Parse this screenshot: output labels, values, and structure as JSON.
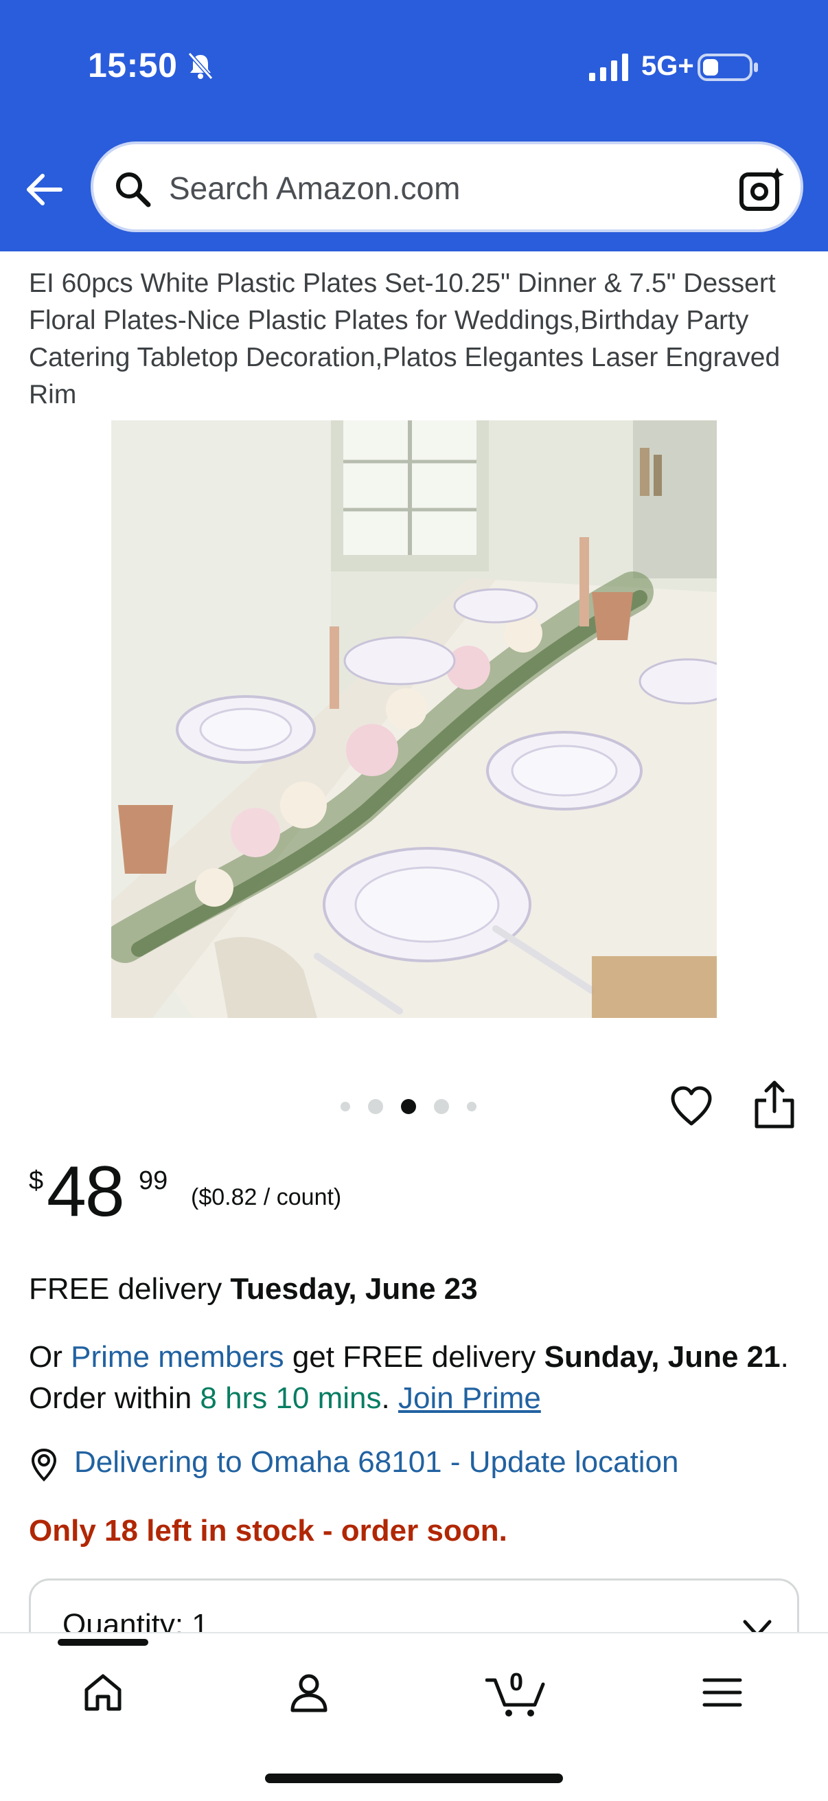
{
  "status_bar": {
    "time": "15:50",
    "network": "5G+"
  },
  "search": {
    "placeholder": "Search Amazon.com"
  },
  "product": {
    "title": "EI 60pcs White Plastic Plates Set-10.25\" Dinner & 7.5\" Dessert Floral Plates-Nice Plastic Plates for Weddings,Birthday Party Catering Tabletop Decoration,Platos Elegantes Laser Engraved Rim",
    "image_alt": "Plastic plates set on a decorated wedding table",
    "carousel": {
      "total": 5,
      "active_index": 2
    }
  },
  "price": {
    "currency": "$",
    "whole": "48",
    "fraction": "99",
    "unit_price": "($0.82 / count)"
  },
  "delivery": {
    "prefix": "FREE delivery ",
    "date": "Tuesday, June 23"
  },
  "prime": {
    "or": "Or ",
    "members_link": "Prime members",
    "get_free": " get FREE delivery ",
    "date": "Sunday, June 21",
    "order_within": ". Order within ",
    "countdown": "8 hrs 10 mins",
    "period": ". ",
    "join_link": "Join Prime"
  },
  "location": {
    "text": "Delivering to Omaha 68101 - Update location"
  },
  "stock": {
    "text": "Only 18 left in stock - order soon."
  },
  "quantity": {
    "label": "Quantity: 1"
  },
  "nav": {
    "cart_count": "0",
    "items": [
      "home-icon",
      "account-icon",
      "cart-icon",
      "menu-icon"
    ]
  },
  "colors": {
    "header": "#2a5ddb",
    "link": "#2162a1",
    "countdown": "#067d62",
    "stock": "#b12704"
  }
}
